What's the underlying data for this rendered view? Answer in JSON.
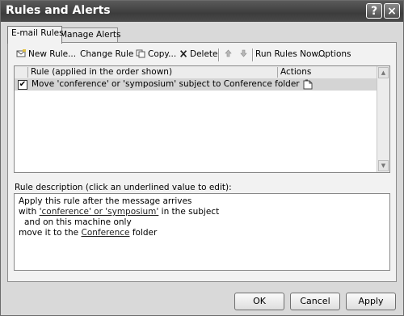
{
  "window": {
    "title": "Rules and Alerts",
    "help_glyph": "?",
    "close_glyph": "×"
  },
  "tabs": [
    {
      "label": "E-mail Rules",
      "active": true
    },
    {
      "label": "Manage Alerts",
      "active": false
    }
  ],
  "toolbar": {
    "new_rule": "New Rule...",
    "change_rule": "Change Rule",
    "copy": "Copy...",
    "delete": "Delete",
    "run_rules_now": "Run Rules Now...",
    "options": "Options"
  },
  "rules_list": {
    "columns": [
      "Rule (applied in the order shown)",
      "Actions"
    ],
    "rows": [
      {
        "checked": true,
        "check_glyph": "✔",
        "text": "Move 'conference' or 'symposium' subject to Conference folder"
      }
    ]
  },
  "description": {
    "label": "Rule description (click an underlined value to edit):",
    "line1": "Apply this rule after the message arrives",
    "line2_prefix": "with ",
    "line2_link1": "'conference' or 'symposium'",
    "line2_suffix": " in the subject",
    "line3": "and on this machine only",
    "line4_prefix": "move it to the ",
    "line4_link": "Conference",
    "line4_suffix": " folder"
  },
  "buttons": {
    "ok": "OK",
    "cancel": "Cancel",
    "apply": "Apply"
  },
  "icons": [
    "new-rule-icon",
    "copy-icon",
    "delete-icon",
    "move-up-icon",
    "move-down-icon",
    "action-move-icon"
  ]
}
